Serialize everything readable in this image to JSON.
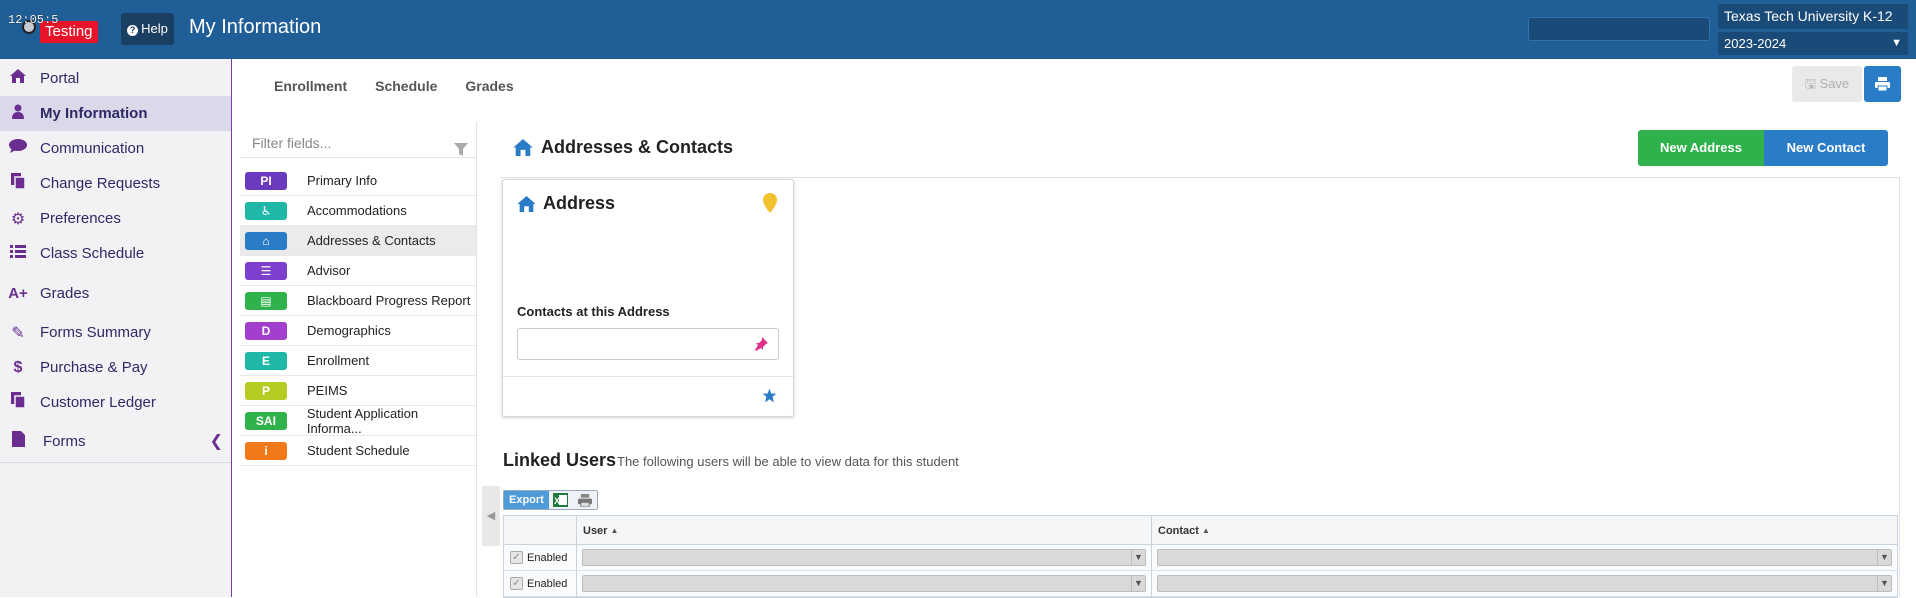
{
  "header": {
    "clock": "12:05:5",
    "env_badge": "Testing",
    "help_label": "Help",
    "page_title": "My Information",
    "org_select": "Texas Tech University K-12",
    "year_select": "2023-2024"
  },
  "sidebar": {
    "items": [
      {
        "label": "Portal",
        "icon": "home-icon"
      },
      {
        "label": "My Information",
        "icon": "user-icon"
      },
      {
        "label": "Communication",
        "icon": "chat-icon"
      },
      {
        "label": "Change Requests",
        "icon": "copy-icon"
      },
      {
        "label": "Preferences",
        "icon": "gear-icon"
      },
      {
        "label": "Class Schedule",
        "icon": "list-icon"
      },
      {
        "label": "Grades",
        "icon": "grade-icon"
      },
      {
        "label": "Forms Summary",
        "icon": "edit-icon"
      },
      {
        "label": "Purchase & Pay",
        "icon": "dollar-icon"
      },
      {
        "label": "Customer Ledger",
        "icon": "ledger-icon"
      },
      {
        "label": "Forms",
        "icon": "file-icon"
      }
    ]
  },
  "tabs": [
    "Enrollment",
    "Schedule",
    "Grades"
  ],
  "toolbar": {
    "save_label": "Save"
  },
  "fields": {
    "filter_placeholder": "Filter fields...",
    "items": [
      {
        "badge": "PI",
        "label": "Primary Info",
        "color": "#6a3bbf"
      },
      {
        "badge": "♿",
        "label": "Accommodations",
        "color": "#1fb8a8"
      },
      {
        "badge": "⌂",
        "label": "Addresses & Contacts",
        "color": "#2a7cc7"
      },
      {
        "badge": "☰",
        "label": "Advisor",
        "color": "#7e3fcf"
      },
      {
        "badge": "▤",
        "label": "Blackboard Progress Report",
        "color": "#2fb24b"
      },
      {
        "badge": "D",
        "label": "Demographics",
        "color": "#a23fcf"
      },
      {
        "badge": "E",
        "label": "Enrollment",
        "color": "#1fb8a8"
      },
      {
        "badge": "P",
        "label": "PEIMS",
        "color": "#b7cc22"
      },
      {
        "badge": "SAI",
        "label": "Student Application Informa...",
        "color": "#2fb24b"
      },
      {
        "badge": "i",
        "label": "Student Schedule",
        "color": "#f07a1a"
      }
    ]
  },
  "main": {
    "section_title": "Addresses & Contacts",
    "new_address": "New Address",
    "new_contact": "New Contact",
    "card": {
      "title": "Address",
      "contacts_label": "Contacts at this Address"
    },
    "linked": {
      "title": "Linked Users",
      "description": "The following users will be able to view data for this student",
      "export_label": "Export",
      "columns": [
        "User",
        "Contact"
      ],
      "rows": [
        {
          "enabled": "Enabled"
        },
        {
          "enabled": "Enabled"
        }
      ]
    }
  },
  "colors": {
    "topbar": "#1f5e96",
    "accent_purple": "#6b2d8f",
    "primary_blue": "#2a7cc7",
    "success_green": "#2fb24b",
    "badge_red": "#e8142a"
  }
}
